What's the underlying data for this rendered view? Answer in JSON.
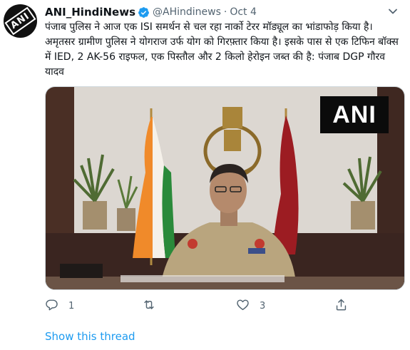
{
  "tweet": {
    "avatar_icon": "ani-logo-icon",
    "avatar_text": "ANI",
    "display_name": "ANI_HindiNews",
    "handle": "@AHindinews",
    "separator": "·",
    "date": "Oct 4",
    "verified_icon": "verified-badge-icon",
    "text": "पंजाब पुलिस ने आज एक ISI समर्थन से चल रहा  नार्को टेरर मॉड्यूल का भांडाफोड़ किया है। अमृतसर ग्रामीण पुलिस ने योगराज उर्फ योग को गिरफ़्तार किया है। इसके पास से एक टिफिन बॉक्स में IED, 2 AK-56 राइफल, एक पिस्तौल और 2 किलो हेरोइन जब्त की है: पंजाब DGP गौरव यादव",
    "media": {
      "watermark": "ANI"
    },
    "actions": {
      "reply_count": "1",
      "retweet_count": "",
      "like_count": "3"
    },
    "show_thread_label": "Show this thread"
  },
  "colors": {
    "link": "#1d9bf0",
    "secondary_text": "#536471",
    "verified": "#1d9bf0"
  }
}
